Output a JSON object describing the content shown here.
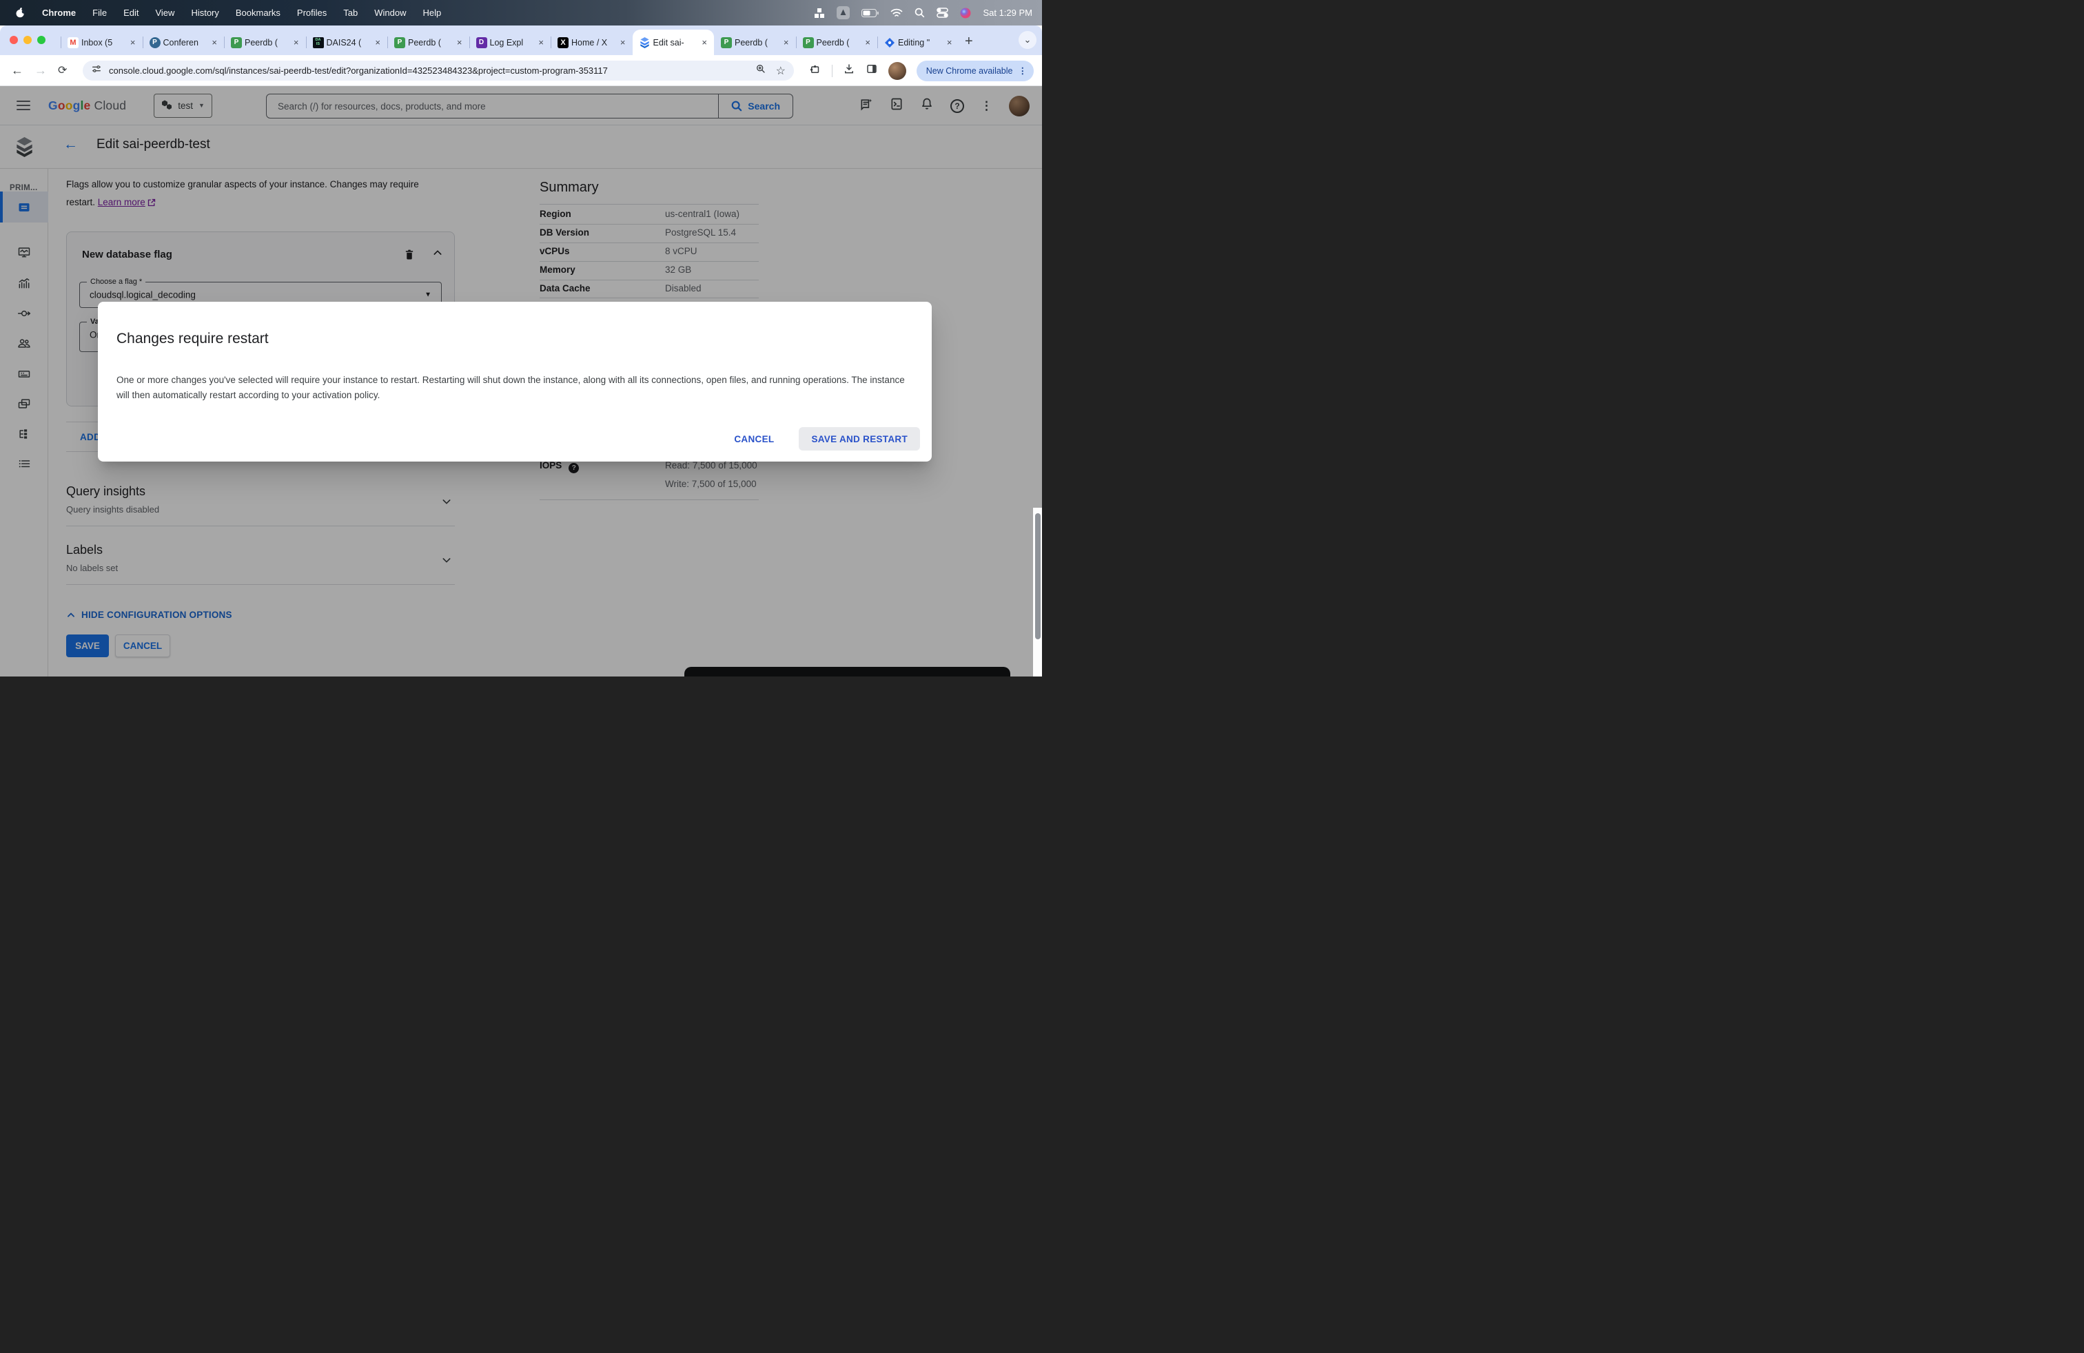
{
  "colors": {
    "accent_blue": "#1a73e8",
    "link_purple": "#7b1fa2",
    "update_pill_bg": "#cbdcf9",
    "modal_button_blue": "#2a52c9"
  },
  "menubar": {
    "items": [
      "Chrome",
      "File",
      "Edit",
      "View",
      "History",
      "Bookmarks",
      "Profiles",
      "Tab",
      "Window",
      "Help"
    ],
    "clock": "Sat 1:29 PM"
  },
  "tabs": [
    {
      "label": "Inbox (5"
    },
    {
      "label": "Conferen"
    },
    {
      "label": "Peerdb ("
    },
    {
      "label": "DAIS24 ("
    },
    {
      "label": "Peerdb ("
    },
    {
      "label": "Log Expl"
    },
    {
      "label": "Home / X"
    },
    {
      "label": "Edit sai-"
    },
    {
      "label": "Peerdb ("
    },
    {
      "label": "Peerdb ("
    },
    {
      "label": "Editing \""
    }
  ],
  "toolbar": {
    "url": "console.cloud.google.com/sql/instances/sai-peerdb-test/edit?organizationId=432523484323&project=custom-program-353117",
    "update_pill": "New Chrome available"
  },
  "gc": {
    "logo_letters": [
      "G",
      "o",
      "o",
      "g",
      "l",
      "e"
    ],
    "logo_cloud": "Cloud",
    "project": "test",
    "search_placeholder": "Search (/) for resources, docs, products, and more",
    "search_btn": "Search"
  },
  "page": {
    "title": "Edit sai-peerdb-test",
    "sidebar_label": "PRIM...",
    "intro_1": "Flags allow you to customize granular aspects of your instance. Changes may require",
    "intro_2": "restart. ",
    "learn_more": "Learn more",
    "card": {
      "title": "New database flag",
      "flag_label": "Choose a flag *",
      "flag_value": "cloudsql.logical_decoding",
      "value_label": "Val",
      "value_value": "On"
    },
    "add_btn": "ADD",
    "query_insights": {
      "title": "Query insights",
      "subtitle": "Query insights disabled"
    },
    "labels": {
      "title": "Labels",
      "subtitle": "No labels set"
    },
    "hide_config": "HIDE CONFIGURATION OPTIONS",
    "save": "SAVE",
    "cancel": "CANCEL",
    "summary": {
      "title": "Summary",
      "rows": [
        {
          "label": "Region",
          "value": "us-central1 (Iowa)"
        },
        {
          "label": "DB Version",
          "value": "PostgreSQL 15.4"
        },
        {
          "label": "vCPUs",
          "value": "8 vCPU"
        },
        {
          "label": "Memory",
          "value": "32 GB"
        },
        {
          "label": "Data Cache",
          "value": "Disabled"
        }
      ],
      "iops_label": "IOPS",
      "iops_read": "Read: 7,500 of 15,000",
      "iops_write": "Write: 7,500 of 15,000"
    }
  },
  "modal": {
    "title": "Changes require restart",
    "body": "One or more changes you've selected will require your instance to restart. Restarting will shut down the instance, along with all its connections, open files, and running operations. The instance will then automatically restart according to your activation policy.",
    "cancel": "CANCEL",
    "confirm": "SAVE AND RESTART"
  }
}
